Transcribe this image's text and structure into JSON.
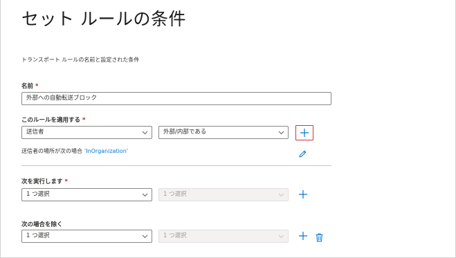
{
  "page": {
    "title": "セット ルールの条件",
    "subtitle": "トランスポート ルールの名前と設定された条件"
  },
  "name_field": {
    "label": "名前",
    "required_mark": "*",
    "value": "外部への自動転送ブロック"
  },
  "apply_rule": {
    "label": "このルールを適用する",
    "required_mark": "*",
    "condition_dropdown": "送信者",
    "value_dropdown": "外部/内部である",
    "add_icon": "plus-icon",
    "highlight_color": "#d13438",
    "description_prefix": "送信者の場所が次の場合",
    "description_value": "'InOrganization'",
    "edit_icon": "pencil-icon"
  },
  "do_following": {
    "label": "次を実行します",
    "required_mark": "*",
    "action_dropdown": "1 つ選択",
    "value_dropdown": "1 つ選択",
    "add_icon": "plus-icon"
  },
  "except_if": {
    "label": "次の場合を除く",
    "condition_dropdown": "1 つ選択",
    "value_dropdown": "1 つ選択",
    "add_icon": "plus-icon",
    "delete_icon": "trash-icon"
  },
  "colors": {
    "accent": "#0078d4",
    "required": "#a4262c",
    "border": "#8a8886",
    "disabled_bg": "#f3f2f1"
  }
}
